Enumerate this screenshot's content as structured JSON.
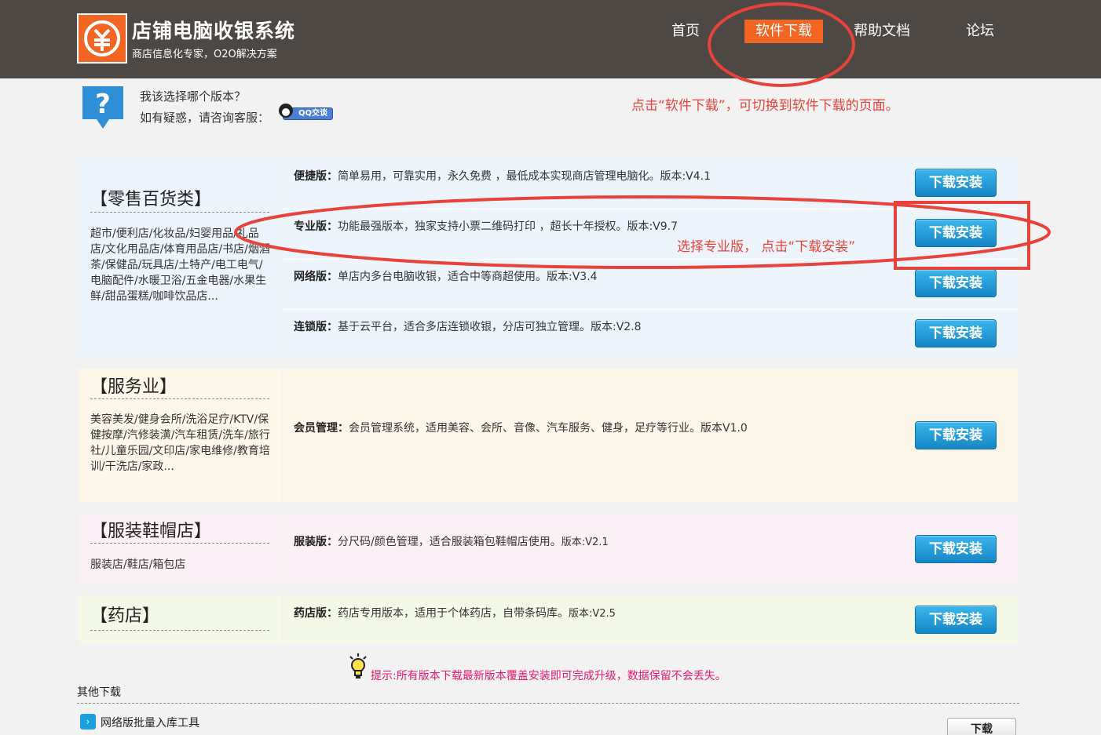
{
  "header": {
    "brand": "店铺电脑收银系统",
    "slogan": "商店信息化专家，O2O解决方案",
    "nav": [
      "首页",
      "软件下载",
      "帮助文档",
      "论坛"
    ],
    "active_index": 1,
    "accent": "#f26522"
  },
  "help": {
    "question": "我该选择哪个版本？",
    "consult": "如有疑惑，请咨询客服：",
    "qq_badge": "QQ交谈"
  },
  "annotations": {
    "nav_hint": "点击“软件下载”，可切换到软件下载的页面。",
    "pro_hint": "选择专业版，  点击“下载安装”",
    "color": "#e8433a"
  },
  "download_label": "下载安装",
  "categories": [
    {
      "title": "【零售百货类】",
      "desc": "超市/便利店/化妆品/妇婴用品/礼品店/文化用品店/体育用品店/书店/烟酒茶/保健品/玩具店/土特产/电工电气/电脑配件/水暖卫浴/五金电器/水果生鲜/甜品蛋糕/咖啡饮品店...",
      "editions": [
        {
          "name": "便捷版：",
          "text": "简单易用，可靠实用，永久免费 ，最低成本实现商店管理电脑化。版本:V4.1"
        },
        {
          "name": "专业版：",
          "text": "功能最强版本，独家支持小票二维码打印 ，超长十年授权。版本:V9.7"
        },
        {
          "name": "网络版：",
          "text": "单店内多台电脑收银，适合中等商超使用。版本:V3.4"
        },
        {
          "name": "连锁版：",
          "text": "基于云平台，适合多店连锁收银，分店可独立管理。版本:V2.8"
        }
      ]
    },
    {
      "title": "【服务业】",
      "desc": "美容美发/健身会所/洗浴足疗/KTV/保健按摩/汽修装潢/汽车租赁/洗车/旅行社/儿童乐园/文印店/家电维修/教育培训/干洗店/家政...",
      "editions": [
        {
          "name": "会员管理：",
          "text": "会员管理系统，适用美容、会所、音像、汽车服务、健身，足疗等行业。版本V1.0"
        }
      ]
    },
    {
      "title": "【服装鞋帽店】",
      "desc": "服装店/鞋店/箱包店",
      "editions": [
        {
          "name": "服装版：",
          "text": "分尺码/颜色管理，适合服装箱包鞋帽店使用。",
          "version": "版本:V2.1"
        }
      ]
    },
    {
      "title": "【药店】",
      "desc": "",
      "editions": [
        {
          "name": "药店版：",
          "text": "药店专用版本，适用于个体药店，自带条码库。",
          "version": "版本:V2.5"
        }
      ]
    }
  ],
  "tip": "提示:所有版本下载最新版本覆盖安装即可完成升级，数据保留不会丢失。",
  "other": {
    "title": "其他下载",
    "item": "网络版批量入库工具",
    "button": "下载"
  }
}
